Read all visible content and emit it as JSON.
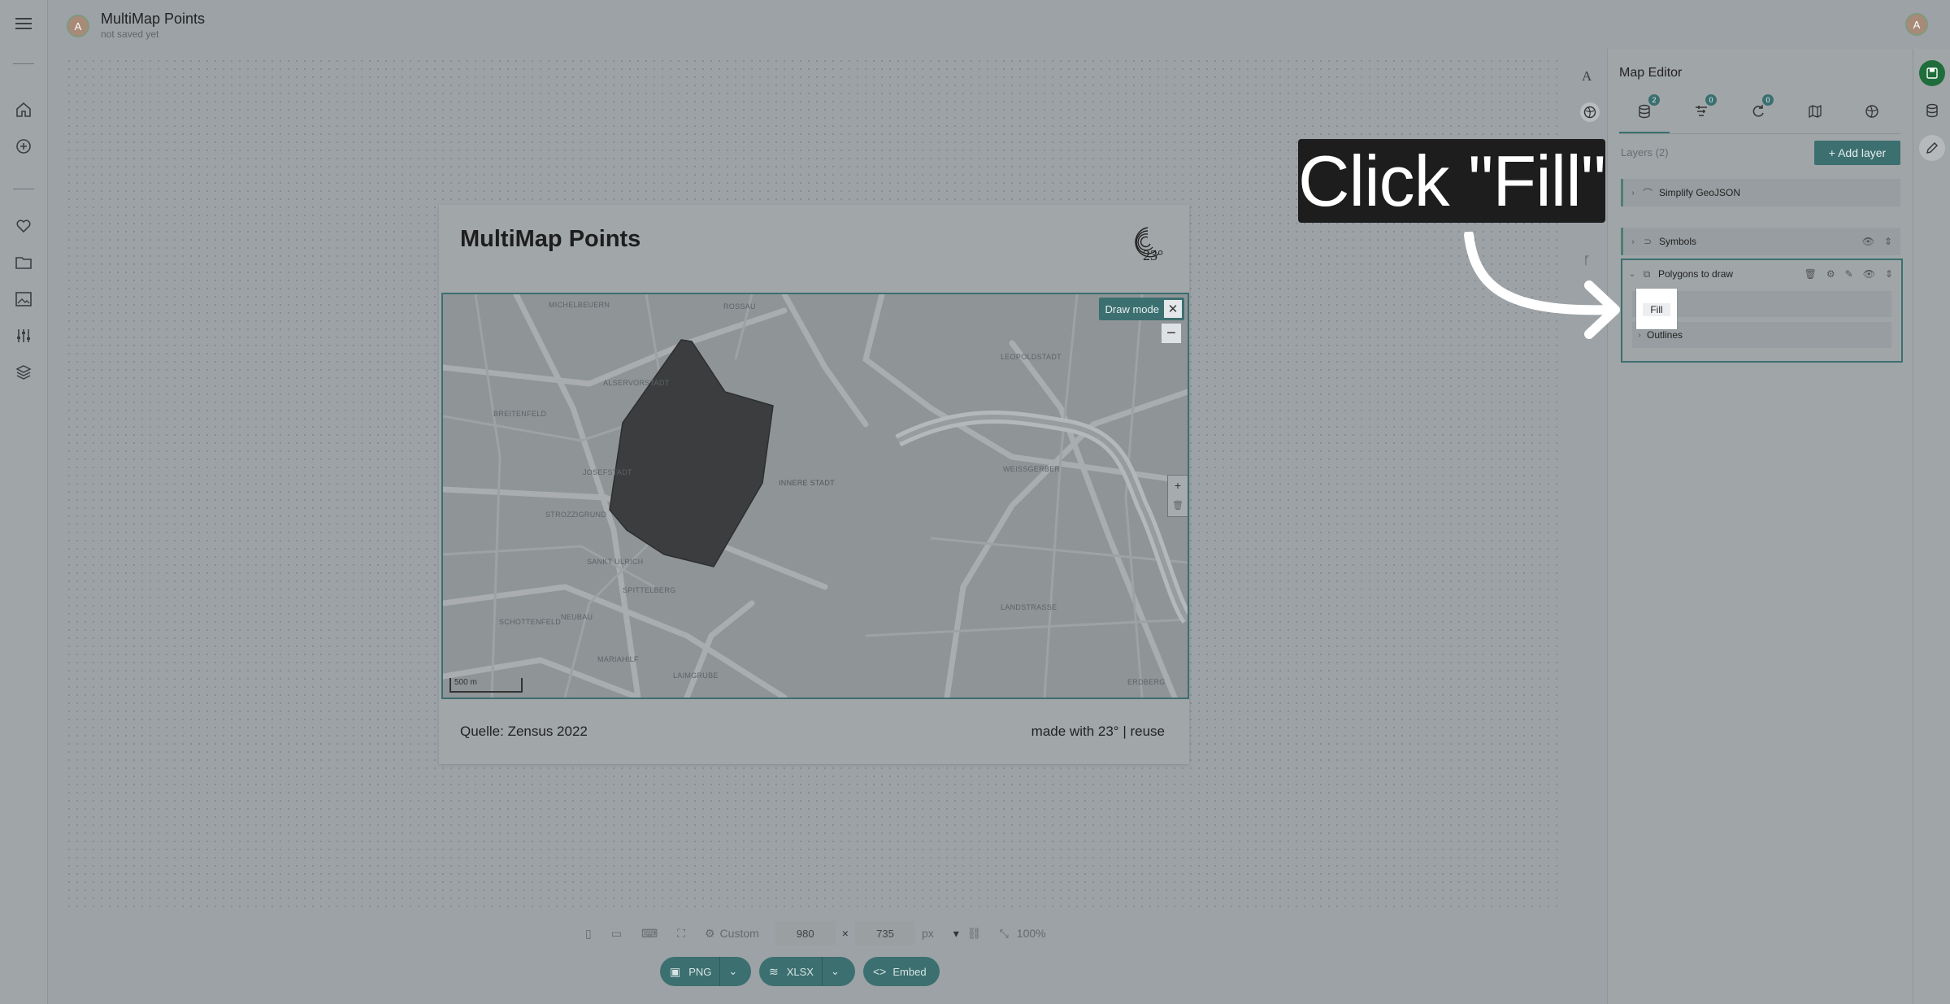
{
  "header": {
    "avatar_initial": "A",
    "title": "MultiMap Points",
    "status": "not saved yet",
    "user_initial": "A"
  },
  "card": {
    "title": "MultiMap Points",
    "logo_text": "23°",
    "source": "Quelle: Zensus 2022",
    "made_with": "made with 23°",
    "reuse": "reuse"
  },
  "map": {
    "draw_mode_label": "Draw mode",
    "scale_label": "500 m",
    "streets": [
      "MICHELBEUERN",
      "ROSSAU",
      "LEOPOLDSTADT",
      "ALSERVORSTADT",
      "BREITENFELD",
      "JOSEFSTADT",
      "INNERE STADT",
      "WEISSGERBER",
      "STROZZIGRUND",
      "SANKT ULRICH",
      "SPITTELBERG",
      "SCHOTTENFELD",
      "NEUBAU",
      "LANDSTRASSE",
      "MARIAHILF",
      "LAIMGRUBE",
      "ERDBERG"
    ]
  },
  "panel": {
    "title": "Map Editor",
    "tabs": [
      {
        "name": "layers",
        "badge": "2"
      },
      {
        "name": "filters",
        "badge": "0"
      },
      {
        "name": "sources",
        "badge": "0"
      },
      {
        "name": "basemap",
        "badge": ""
      },
      {
        "name": "projection",
        "badge": ""
      }
    ],
    "layers_count": "Layers (2)",
    "add_layer": "+ Add layer",
    "layers": [
      {
        "label": "Simplify GeoJSON"
      },
      {
        "label": "Symbols"
      },
      {
        "label": "Polygons to draw"
      }
    ],
    "sublayers": [
      "Fill",
      "Outlines"
    ]
  },
  "size_bar": {
    "preset": "Custom",
    "width": "980",
    "times": "×",
    "height": "735",
    "unit": "px",
    "zoom": "100%"
  },
  "export": {
    "png": "PNG",
    "xlsx": "XLSX",
    "embed": "Embed"
  },
  "callout": {
    "text": "Click \"Fill\""
  }
}
